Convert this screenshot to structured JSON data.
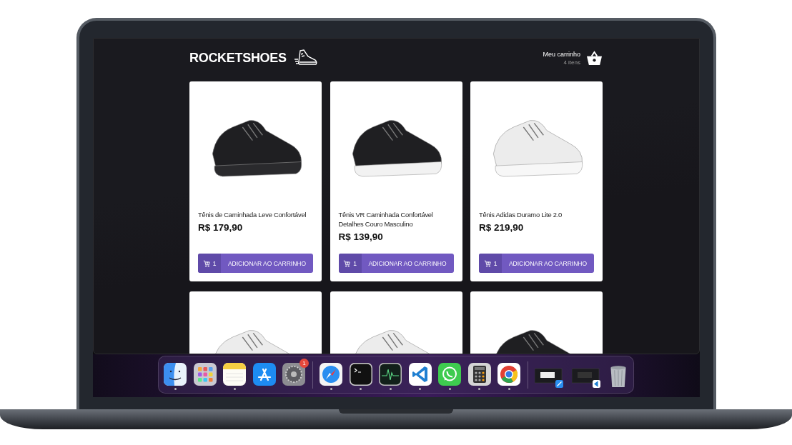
{
  "header": {
    "brand": "ROCKETSHOES",
    "cart_label": "Meu carrinho",
    "cart_count": "4 itens"
  },
  "products": [
    {
      "kind": "black-shoe",
      "title": "Tênis de Caminhada Leve Confortável",
      "price": "R$ 179,90",
      "quantity": "1",
      "button": "ADICIONAR AO CARRINHO"
    },
    {
      "kind": "black-white-shoe",
      "title": "Tênis VR Caminhada Confortável Detalhes Couro Masculino",
      "price": "R$ 139,90",
      "quantity": "1",
      "button": "ADICIONAR AO CARRINHO"
    },
    {
      "kind": "white-shoe",
      "title": "Tênis Adidas Duramo Lite 2.0",
      "price": "R$ 219,90",
      "quantity": "1",
      "button": "ADICIONAR AO CARRINHO"
    },
    {
      "kind": "white-shoe"
    },
    {
      "kind": "white-shoe"
    },
    {
      "kind": "black-shoe"
    }
  ],
  "dock": [
    {
      "kind": "finder",
      "running": true
    },
    {
      "kind": "launchpad",
      "running": false
    },
    {
      "kind": "notes",
      "running": true
    },
    {
      "kind": "appstore",
      "running": false
    },
    {
      "kind": "settings",
      "running": false,
      "badge": "1"
    },
    {
      "kind": "separator"
    },
    {
      "kind": "safari",
      "running": true
    },
    {
      "kind": "terminal",
      "running": true
    },
    {
      "kind": "monitor",
      "running": true
    },
    {
      "kind": "vscode",
      "running": true
    },
    {
      "kind": "whatsapp",
      "running": true
    },
    {
      "kind": "calculator",
      "running": true
    },
    {
      "kind": "chrome",
      "running": true
    },
    {
      "kind": "separator"
    },
    {
      "kind": "window-safari"
    },
    {
      "kind": "window-vscode"
    },
    {
      "kind": "trash"
    }
  ]
}
